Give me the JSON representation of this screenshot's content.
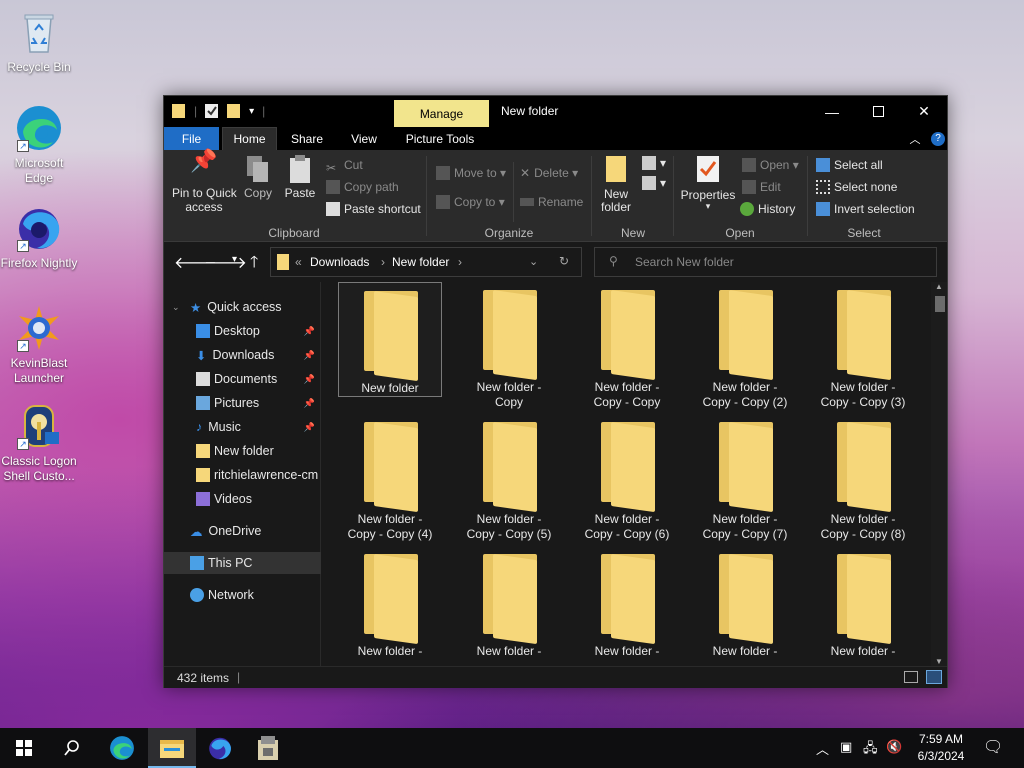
{
  "desktop": {
    "icons": [
      {
        "label": "Recycle Bin"
      },
      {
        "label": "Microsoft Edge"
      },
      {
        "label": "Firefox Nightly"
      },
      {
        "label": "KevinBlast Launcher"
      },
      {
        "label": "Classic Logon Shell Custo..."
      }
    ]
  },
  "window": {
    "title": "New folder",
    "manage_tab": "Manage",
    "tabs": [
      "File",
      "Home",
      "Share",
      "View",
      "Picture Tools"
    ],
    "ribbon": {
      "clipboard": {
        "group": "Clipboard",
        "pin": "Pin to Quick access",
        "pin_l1": "Pin to Quick",
        "pin_l2": "access",
        "copy": "Copy",
        "paste": "Paste",
        "cut": "Cut",
        "copy_path": "Copy path",
        "paste_shortcut": "Paste shortcut"
      },
      "organize": {
        "group": "Organize",
        "move_to": "Move to",
        "copy_to": "Copy to",
        "delete": "Delete",
        "rename": "Rename"
      },
      "new": {
        "group": "New",
        "new_folder_l1": "New",
        "new_folder_l2": "folder"
      },
      "open": {
        "group": "Open",
        "properties": "Properties",
        "open": "Open",
        "edit": "Edit",
        "history": "History"
      },
      "select": {
        "group": "Select",
        "select_all": "Select all",
        "select_none": "Select none",
        "invert": "Invert selection"
      }
    },
    "address": {
      "prefix": "«",
      "crumbs": [
        "Downloads",
        "New folder"
      ]
    },
    "search_placeholder": "Search New folder",
    "nav": {
      "quick_access": "Quick access",
      "items": [
        {
          "label": "Desktop",
          "pinned": true
        },
        {
          "label": "Downloads",
          "pinned": true
        },
        {
          "label": "Documents",
          "pinned": true
        },
        {
          "label": "Pictures",
          "pinned": true
        },
        {
          "label": "Music",
          "pinned": true
        },
        {
          "label": "New folder",
          "pinned": false
        },
        {
          "label": "ritchielawrence-cm",
          "pinned": false
        },
        {
          "label": "Videos",
          "pinned": false
        }
      ],
      "onedrive": "OneDrive",
      "this_pc": "This PC",
      "network": "Network"
    },
    "files": [
      {
        "l1": "New folder",
        "l2": ""
      },
      {
        "l1": "New folder -",
        "l2": "Copy"
      },
      {
        "l1": "New folder -",
        "l2": "Copy - Copy"
      },
      {
        "l1": "New folder -",
        "l2": "Copy - Copy (2)"
      },
      {
        "l1": "New folder -",
        "l2": "Copy - Copy (3)"
      },
      {
        "l1": "New folder -",
        "l2": "Copy - Copy (4)"
      },
      {
        "l1": "New folder -",
        "l2": "Copy - Copy (5)"
      },
      {
        "l1": "New folder -",
        "l2": "Copy - Copy (6)"
      },
      {
        "l1": "New folder -",
        "l2": "Copy - Copy (7)"
      },
      {
        "l1": "New folder -",
        "l2": "Copy - Copy (8)"
      },
      {
        "l1": "New folder -",
        "l2": ""
      },
      {
        "l1": "New folder -",
        "l2": ""
      },
      {
        "l1": "New folder -",
        "l2": ""
      },
      {
        "l1": "New folder -",
        "l2": ""
      },
      {
        "l1": "New folder -",
        "l2": ""
      }
    ],
    "status": {
      "items": "432 items"
    }
  },
  "taskbar": {
    "time": "7:59 AM",
    "date": "6/3/2024"
  },
  "colors": {
    "file_tab": "#1f6dc6",
    "manage_tab": "#f2e58d",
    "folder": "#f6d77a",
    "window_bg": "#191919"
  }
}
